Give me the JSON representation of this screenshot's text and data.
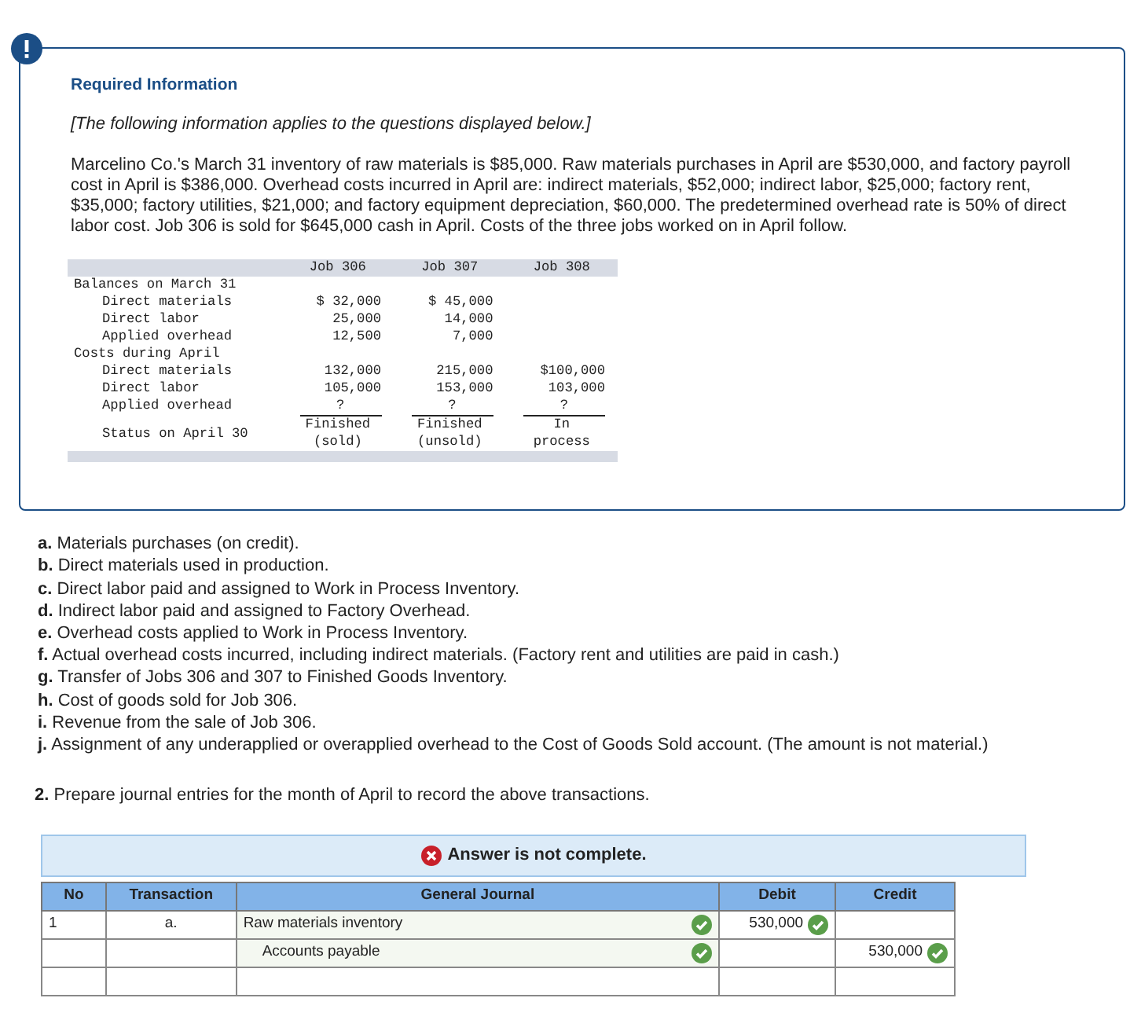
{
  "info": {
    "title": "Required Information",
    "note": "[The following information applies to the questions displayed below.]",
    "paragraph": "Marcelino Co.'s March 31 inventory of raw materials is $85,000. Raw materials purchases in April are $530,000, and factory payroll cost in April is $386,000. Overhead costs incurred in April are: indirect materials, $52,000; indirect labor, $25,000; factory rent, $35,000; factory utilities, $21,000; and factory equipment depreciation, $60,000. The predetermined overhead rate is 50% of direct labor cost. Job 306 is sold for $645,000 cash in April. Costs of the three jobs worked on in April follow.",
    "cost_table": {
      "columns": [
        "Job 306",
        "Job 307",
        "Job 308"
      ],
      "rows": [
        {
          "kind": "section",
          "label": "Balances on March 31",
          "values": []
        },
        {
          "kind": "item",
          "label": "Direct materials",
          "values": [
            "$ 32,000",
            "$ 45,000"
          ]
        },
        {
          "kind": "item",
          "label": "Direct labor",
          "values": [
            "25,000",
            "14,000"
          ]
        },
        {
          "kind": "item",
          "label": "Applied overhead",
          "values": [
            "12,500",
            "7,000"
          ]
        },
        {
          "kind": "section",
          "label": "Costs during April",
          "values": []
        },
        {
          "kind": "item",
          "label": "Direct materials",
          "values": [
            "132,000",
            "215,000",
            "$100,000"
          ]
        },
        {
          "kind": "item",
          "label": "Direct labor",
          "values": [
            "105,000",
            "153,000",
            "103,000"
          ]
        },
        {
          "kind": "subtotal",
          "label": "Applied overhead",
          "values": [
            "?",
            "?",
            "?"
          ]
        },
        {
          "kind": "status",
          "label": "Status on April 30",
          "values": [
            [
              "Finished",
              "(sold)"
            ],
            [
              "Finished",
              "(unsold)"
            ],
            [
              "In",
              "process"
            ]
          ]
        }
      ]
    }
  },
  "transactions": [
    {
      "letter": "a.",
      "text": "Materials purchases (on credit)."
    },
    {
      "letter": "b.",
      "text": "Direct materials used in production."
    },
    {
      "letter": "c.",
      "text": "Direct labor paid and assigned to Work in Process Inventory."
    },
    {
      "letter": "d.",
      "text": "Indirect labor paid and assigned to Factory Overhead."
    },
    {
      "letter": "e.",
      "text": "Overhead costs applied to Work in Process Inventory."
    },
    {
      "letter": "f.",
      "text": "Actual overhead costs incurred, including indirect materials. (Factory rent and utilities are paid in cash.)"
    },
    {
      "letter": "g.",
      "text": "Transfer of Jobs 306 and 307 to Finished Goods Inventory."
    },
    {
      "letter": "h.",
      "text": "Cost of goods sold for Job 306."
    },
    {
      "letter": "i.",
      "text": "Revenue from the sale of Job 306."
    },
    {
      "letter": "j.",
      "text": "Assignment of any underapplied or overapplied overhead to the Cost of Goods Sold account. (The amount is not material.)"
    }
  ],
  "question": {
    "number": "2.",
    "text": "Prepare journal entries for the month of April to record the above transactions."
  },
  "answer": {
    "complete": false,
    "message": "Answer is not complete."
  },
  "journal": {
    "columns": [
      "No",
      "Transaction",
      "General Journal",
      "Debit",
      "Credit"
    ],
    "rows": [
      {
        "no": "1",
        "transaction": "a.",
        "indented": false,
        "account": "Raw materials inventory",
        "account_correct": true,
        "debit": "530,000",
        "debit_correct": true
      },
      {
        "indented": true,
        "account": "Accounts payable",
        "account_correct": true,
        "credit": "530,000",
        "credit_correct": true
      }
    ]
  }
}
